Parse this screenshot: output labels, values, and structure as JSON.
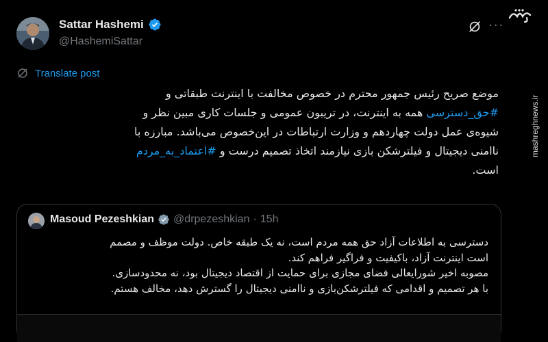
{
  "author": {
    "name": "Sattar Hashemi",
    "handle": "@HashemiSattar"
  },
  "watermark": {
    "logo_text": "مشرق",
    "site": "mashreghnews.ir"
  },
  "translate": {
    "label": "Translate post"
  },
  "post": {
    "lines": [
      [
        {
          "t": "موضع صریح رئیس جمهور محترم در خصوص مخالفت با اینترنت طبقاتی و"
        }
      ],
      [
        {
          "t": "#حق_دسترسی",
          "tag": true
        },
        {
          "t": " همه به اینترنت، در تریبون عمومی و جلسات کاری مبین نظر و"
        }
      ],
      [
        {
          "t": "شیوه‌ی عمل دولت چهاردهم و وزارت ارتباطات در این‌خصوص می‌باشد. مبارزه با"
        }
      ],
      [
        {
          "t": "ناامنی دیجیتال و فیلترشکن بازی نیازمند اتخاذ تصمیم درست و "
        },
        {
          "t": "#اعتماد_به_مردم",
          "tag": true
        }
      ],
      [
        {
          "t": "است."
        }
      ]
    ]
  },
  "quote": {
    "name": "Masoud Pezeshkian",
    "handle": "@drpezeshkian",
    "dot": "·",
    "time": "15h",
    "lines": [
      "دسترسی به اطلاعات آزاد حق همه مردم است، نه یک طبقه خاص. دولت موظف و مصمم",
      "است اینترنت آزاد، باکیفیت و فراگیر فراهم کند.",
      "مصوبه اخیر شورایعالی فضای مجازی برای حمایت از اقتصاد دیجیتال بود، نه محدودسازی.",
      "با هر تصمیم و اقدامی که فیلترشکن‌بازی و ناامنی دیجیتال را گسترش دهد، مخالف هستم."
    ]
  },
  "colors": {
    "background": "#000000",
    "text": "#e7e9ea",
    "muted": "#71767b",
    "accent": "#1d9bf0",
    "border": "#2f3336"
  },
  "icons": [
    "verified-badge-icon",
    "grok-icon",
    "more-icon",
    "translate-icon"
  ]
}
